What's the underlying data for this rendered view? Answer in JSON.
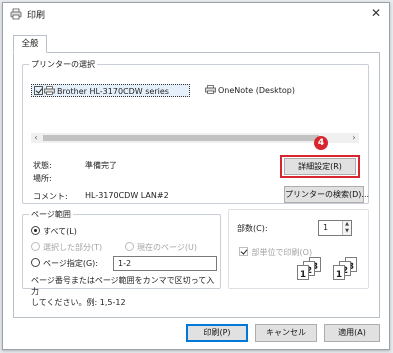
{
  "window": {
    "title": "印刷"
  },
  "tabs": [
    "全般"
  ],
  "printer_section": {
    "legend": "プリンターの選択",
    "printers": [
      {
        "name": "Brother HL-3170CDW series",
        "selected": true
      },
      {
        "name": "OneNote (Desktop)",
        "selected": false
      }
    ],
    "status_label": "状態:",
    "status_value": "準備完了",
    "location_label": "場所:",
    "comment_label": "コメント:",
    "comment_value": "HL-3170CDW LAN#2",
    "preferences_button": "詳細設定(R)",
    "find_printer_button": "プリンターの検索(D)...",
    "annotation_badge": "4"
  },
  "page_range": {
    "legend": "ページ範囲",
    "all": "すべて(L)",
    "selection": "選択した部分(T)",
    "current_page": "現在のページ(U)",
    "pages": "ページ指定(G):",
    "pages_value": "1-2",
    "note_line1": "ページ番号またはページ範囲をカンマで区切って入力",
    "note_line2": "してください。例: 1,5-12"
  },
  "copies": {
    "label": "部数(C):",
    "value": "1",
    "collate_label": "部単位で印刷(O)",
    "collate_icon_numbers": [
      "1",
      "2",
      "3",
      "1",
      "2",
      "3"
    ]
  },
  "buttons": {
    "print": "印刷(P)",
    "cancel": "キャンセル",
    "apply": "適用(A)"
  },
  "colors": {
    "highlight": "#d7262e",
    "accent": "#0078d7"
  }
}
